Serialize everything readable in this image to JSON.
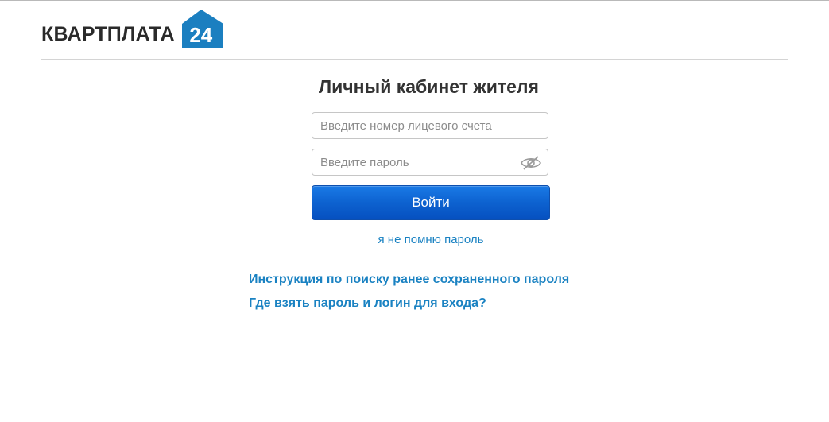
{
  "header": {
    "logo_text": "КВАРТПЛАТА",
    "logo_number": "24",
    "logo_color": "#1b7fc0"
  },
  "login": {
    "title": "Личный кабинет жителя",
    "account_placeholder": "Введите номер лицевого счета",
    "account_value": "",
    "password_placeholder": "Введите пароль",
    "password_value": "",
    "password_toggle_icon": "eye-slash-icon",
    "submit_label": "Войти",
    "submit_color": "#0d62d0",
    "forgot_label": "я не помню пароль"
  },
  "help_links": [
    {
      "label": "Инструкция по поиску ранее сохраненного пароля"
    },
    {
      "label": "Где взять пароль и логин для входа?"
    }
  ],
  "colors": {
    "link": "#1a82c2",
    "title": "#333333"
  }
}
